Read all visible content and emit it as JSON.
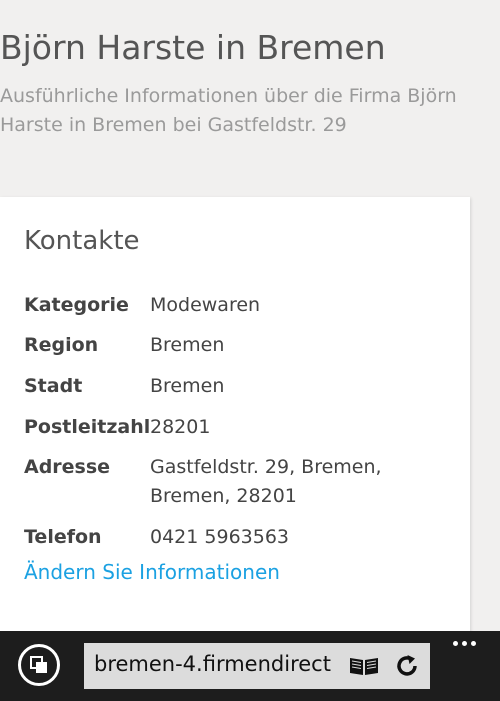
{
  "header": {
    "title": "Björn Harste in Bremen",
    "subtitle": "Ausführliche Informationen über die Firma Björn Harste in Bremen bei Gastfeldstr. 29"
  },
  "card": {
    "title": "Kontakte",
    "rows": [
      {
        "label": "Kategorie",
        "value": "Modewaren"
      },
      {
        "label": "Region",
        "value": "Bremen"
      },
      {
        "label": "Stadt",
        "value": "Bremen"
      },
      {
        "label": "Postleitzahl",
        "value": "28201"
      },
      {
        "label": "Adresse",
        "value": "Gastfeldstr. 29, Bremen, Bremen, 28201"
      },
      {
        "label": "Telefon",
        "value": "0421 5963563"
      }
    ],
    "edit_link": "Ändern Sie Informationen"
  },
  "browser": {
    "url": "bremen-4.firmendirect",
    "icons": {
      "tabs": "tabs-icon",
      "reader": "reader-view-icon",
      "refresh": "refresh-icon",
      "more": "more-options-icon"
    }
  },
  "colors": {
    "background": "#f1f0ef",
    "card": "#ffffff",
    "link": "#1ba1e2",
    "browser_bar": "#1d1d1d",
    "address_box": "#dcdcdc"
  }
}
